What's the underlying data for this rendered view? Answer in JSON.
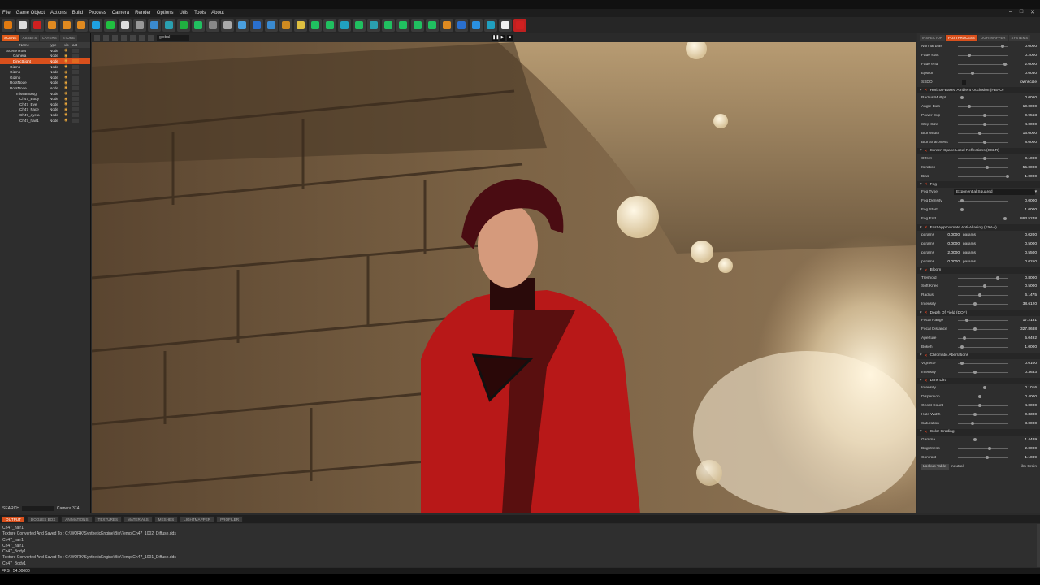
{
  "menu": [
    "File",
    "Game Object",
    "Actions",
    "Build",
    "Process",
    "Camera",
    "Render",
    "Options",
    "Utils",
    "Tools",
    "About"
  ],
  "window_controls": [
    "–",
    "□",
    "✕"
  ],
  "toolbar_icons": [
    "logo-icon",
    "stormtrooper-icon",
    "red-bottle-icon",
    "select-arrow-icon",
    "move-icon",
    "rotate-icon",
    "scale-icon",
    "transform-icon",
    "box-icon",
    "terminal-icon",
    "cube-icon",
    "cube2-icon",
    "android-icon",
    "gear-icon",
    "database-icon",
    "cube3-icon",
    "cube4-icon",
    "cube5-icon",
    "pencil-icon",
    "landscape-icon",
    "slider-icon",
    "hand-icon",
    "leaf-icon",
    "cube6-icon",
    "cube7-icon",
    "cube8-icon",
    "cube9-icon",
    "brush-icon",
    "foliage-icon",
    "leaf2-icon",
    "bookmark-icon",
    "camera-icon",
    "globe-icon",
    "world-icon",
    "settings-icon",
    "close-icon"
  ],
  "left_tabs": [
    "SCENE",
    "ASSETS",
    "LAYERS",
    "STORE"
  ],
  "hierarchy": {
    "headers": [
      "Name",
      "type",
      "vis",
      "act"
    ],
    "rows": [
      {
        "name": "Scene Root",
        "type": "Node",
        "selected": false,
        "indent": 1
      },
      {
        "name": "Camera",
        "type": "Node",
        "selected": false,
        "indent": 3
      },
      {
        "name": "DirectLight",
        "type": "Node",
        "selected": true,
        "indent": 3
      },
      {
        "name": "Gizmo",
        "type": "Node",
        "selected": false,
        "indent": 2
      },
      {
        "name": "Gizmo",
        "type": "Node",
        "selected": false,
        "indent": 2
      },
      {
        "name": "Gizmo",
        "type": "Node",
        "selected": false,
        "indent": 2
      },
      {
        "name": "RootNode",
        "type": "Node",
        "selected": false,
        "indent": 2
      },
      {
        "name": "RootNode",
        "type": "Node",
        "selected": false,
        "indent": 2
      },
      {
        "name": "missamorsg",
        "type": "Node",
        "selected": false,
        "indent": 4
      },
      {
        "name": "Ch47_Body",
        "type": "Node",
        "selected": false,
        "indent": 5
      },
      {
        "name": "Ch47_Eye",
        "type": "Node",
        "selected": false,
        "indent": 5
      },
      {
        "name": "Ch47_Face",
        "type": "Node",
        "selected": false,
        "indent": 5
      },
      {
        "name": "Ch47_eyela",
        "type": "Node",
        "selected": false,
        "indent": 5
      },
      {
        "name": "Ch47_hair1",
        "type": "Node",
        "selected": false,
        "indent": 5
      }
    ]
  },
  "search": {
    "label": "SEARCH",
    "value": "Camera 374"
  },
  "viewport": {
    "mode": "global"
  },
  "right_tabs": [
    "INSPECTOR",
    "POSTPROCESS",
    "LIGHTMAPPER",
    "SYSTEMS"
  ],
  "post_sections": [
    {
      "title": null,
      "props": [
        {
          "label": "Normal bias",
          "value": "0.0000",
          "pos": 0.85
        },
        {
          "label": "Fade start",
          "value": "0.2000",
          "pos": 0.2
        },
        {
          "label": "Fade end",
          "value": "2.0000",
          "pos": 0.9
        },
        {
          "label": "Epsilon",
          "value": "0.0050",
          "pos": 0.25
        },
        {
          "label": "SSDO",
          "value": "ownscale",
          "check": true
        }
      ]
    },
    {
      "title": "Horizon-Based Ambient Occlusion (HBAO)",
      "props": [
        {
          "label": "Radius Multipl",
          "value": "0.0060",
          "pos": 0.05
        },
        {
          "label": "Angle Bias",
          "value": "10.0000",
          "pos": 0.2
        },
        {
          "label": "Power Exp",
          "value": "0.9563",
          "pos": 0.5
        },
        {
          "label": "Step Size",
          "value": "4.0000",
          "pos": 0.5
        },
        {
          "label": "Blur Width",
          "value": "16.0000",
          "pos": 0.4
        },
        {
          "label": "Blur Sharpness",
          "value": "8.0000",
          "pos": 0.5
        }
      ]
    },
    {
      "title": "Screen Space Local Reflections (SSLR)",
      "props": [
        {
          "label": "Offset",
          "value": "0.1000",
          "pos": 0.5
        },
        {
          "label": "Iteration",
          "value": "55.0000",
          "pos": 0.55
        },
        {
          "label": "Bias",
          "value": "1.0000",
          "pos": 0.95
        }
      ]
    },
    {
      "title": "Fog",
      "props": [
        {
          "label": "Fog Type",
          "value": "Exponential Squared",
          "dropdown": true
        },
        {
          "label": "Fog Density",
          "value": "0.0000",
          "pos": 0.05
        },
        {
          "label": "Fog Start",
          "value": "1.0000",
          "pos": 0.05
        },
        {
          "label": "Fog End",
          "value": "863.5248",
          "pos": 0.9
        }
      ]
    },
    {
      "title": "Fast Approximate Anti-Aliasing (FXAA)",
      "props": [
        {
          "label": "params",
          "value": "0.0000",
          "label2": "params",
          "value2": "0.0200"
        },
        {
          "label": "params",
          "value": "0.0000",
          "label2": "params",
          "value2": "0.5000"
        },
        {
          "label": "params",
          "value": "2.0000",
          "label2": "params",
          "value2": "0.5500"
        },
        {
          "label": "params",
          "value": "0.0000",
          "label2": "params",
          "value2": "0.0250"
        }
      ]
    },
    {
      "title": "Bloom",
      "props": [
        {
          "label": "Treshold",
          "value": "0.8000",
          "pos": 0.75
        },
        {
          "label": "Soft Knee",
          "value": "0.5000",
          "pos": 0.5
        },
        {
          "label": "Radius",
          "value": "6.1475",
          "pos": 0.4
        },
        {
          "label": "Intensity",
          "value": "38.6120",
          "pos": 0.3
        }
      ]
    },
    {
      "title": "Depth Of Field (DOF)",
      "props": [
        {
          "label": "Focal Range",
          "value": "17.2131",
          "pos": 0.15
        },
        {
          "label": "Focal Distance",
          "value": "327.8688",
          "pos": 0.3
        },
        {
          "label": "Aperture",
          "value": "5.0492",
          "pos": 0.1
        },
        {
          "label": "Bokeh",
          "value": "1.0000",
          "pos": 0.05
        }
      ]
    },
    {
      "title": "Chromatic Aberrations",
      "props": [
        {
          "label": "Vignette",
          "value": "0.0100",
          "pos": 0.05
        },
        {
          "label": "Intensity",
          "value": "0.3633",
          "pos": 0.3
        }
      ]
    },
    {
      "title": "Lens Dirt",
      "props": [
        {
          "label": "Intensity",
          "value": "0.1016",
          "pos": 0.5
        },
        {
          "label": "Dispersion",
          "value": "0.4000",
          "pos": 0.4
        },
        {
          "label": "Ghost Count",
          "value": "4.0000",
          "pos": 0.4
        },
        {
          "label": "Halo Width",
          "value": "0.3300",
          "pos": 0.3
        },
        {
          "label": "Saturation",
          "value": "3.0000",
          "pos": 0.25
        }
      ]
    },
    {
      "title": "Color Grading",
      "props": [
        {
          "label": "Gamma",
          "value": "1.4489",
          "pos": 0.3
        },
        {
          "label": "Brightness",
          "value": "2.0000",
          "pos": 0.6
        },
        {
          "label": "Contrast",
          "value": "1.1089",
          "pos": 0.55
        },
        {
          "label": "Lookup Table",
          "value": "neutral",
          "extra": "ilm Grain",
          "lut": true
        }
      ]
    }
  ],
  "bottom_tabs": [
    "OUTPUT",
    "DOOZES BOX",
    "ANIMATIONS",
    "TEXTURES",
    "MATERIALS",
    "MESHES",
    "LIGHTMAPPER",
    "PROFILER"
  ],
  "console": [
    "Ch47_hair1",
    "Texture Converted And Saved To : C:\\WORK\\SyntheticEngine\\Bin\\Temp\\Ch47_1002_Diffuse.dds",
    "Ch47_hair1",
    "Ch47_hair1",
    "Ch47_Body1",
    "Texture Converted And Saved To : C:\\WORK\\SyntheticEngine\\Bin\\Temp\\Ch47_1001_Diffuse.dds",
    "Ch47_Body1"
  ],
  "status": "FPS : 54.00000",
  "colors": {
    "accent": "#d9501c",
    "eye": "#e8a53a",
    "suit": "#b81818"
  }
}
